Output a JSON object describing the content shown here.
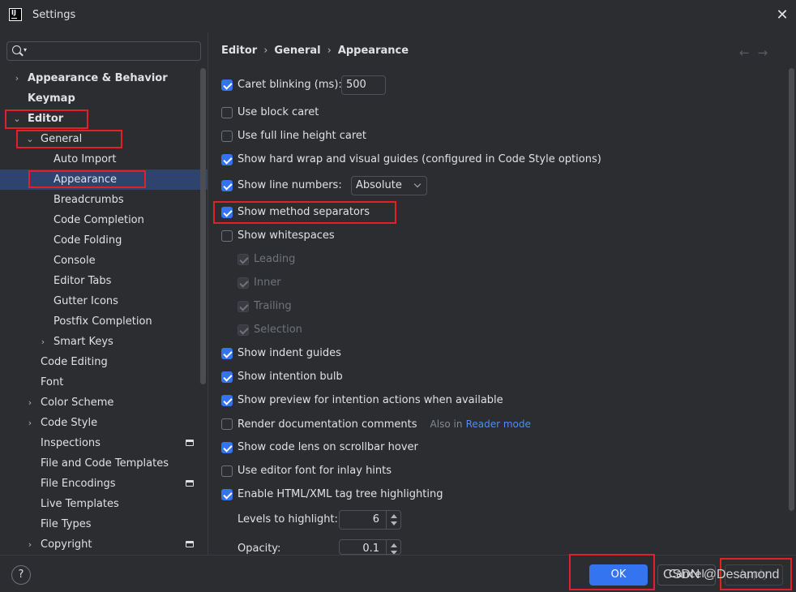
{
  "window": {
    "title": "Settings",
    "logo_text": "IJ",
    "close_glyph": "✕"
  },
  "search": {
    "placeholder": ""
  },
  "sidebar": {
    "items": [
      {
        "label": "Appearance & Behavior",
        "arrow": "›"
      },
      {
        "label": "Keymap"
      },
      {
        "label": "Editor",
        "arrow": "⌄"
      },
      {
        "label": "General",
        "arrow": "⌄"
      },
      {
        "label": "Auto Import"
      },
      {
        "label": "Appearance"
      },
      {
        "label": "Breadcrumbs"
      },
      {
        "label": "Code Completion"
      },
      {
        "label": "Code Folding"
      },
      {
        "label": "Console"
      },
      {
        "label": "Editor Tabs"
      },
      {
        "label": "Gutter Icons"
      },
      {
        "label": "Postfix Completion"
      },
      {
        "label": "Smart Keys",
        "arrow": "›"
      },
      {
        "label": "Code Editing"
      },
      {
        "label": "Font"
      },
      {
        "label": "Color Scheme",
        "arrow": "›"
      },
      {
        "label": "Code Style",
        "arrow": "›"
      },
      {
        "label": "Inspections"
      },
      {
        "label": "File and Code Templates"
      },
      {
        "label": "File Encodings"
      },
      {
        "label": "Live Templates"
      },
      {
        "label": "File Types"
      },
      {
        "label": "Copyright",
        "arrow": "›"
      }
    ]
  },
  "breadcrumb": {
    "part1": "Editor",
    "part2": "General",
    "part3": "Appearance",
    "sep": "›"
  },
  "nav": {
    "back": "←",
    "forward": "→"
  },
  "options": {
    "caret_blinking": "Caret blinking (ms):",
    "caret_blinking_value": "500",
    "block_caret": "Use block caret",
    "full_line_caret": "Use full line height caret",
    "hard_wrap": "Show hard wrap and visual guides (configured in Code Style options)",
    "line_numbers": "Show line numbers:",
    "line_numbers_value": "Absolute",
    "method_separators": "Show method separators",
    "whitespaces": "Show whitespaces",
    "leading": "Leading",
    "inner": "Inner",
    "trailing": "Trailing",
    "selection": "Selection",
    "indent_guides": "Show indent guides",
    "intention_bulb": "Show intention bulb",
    "preview_intention": "Show preview for intention actions when available",
    "render_docs": "Render documentation comments",
    "render_docs_hint": "Also in",
    "render_docs_link": "Reader mode",
    "code_lens": "Show code lens on scrollbar hover",
    "inlay_font": "Use editor font for inlay hints",
    "tag_tree": "Enable HTML/XML tag tree highlighting",
    "levels_label": "Levels to highlight:",
    "levels_value": "6",
    "opacity_label": "Opacity:",
    "opacity_value": "0.1"
  },
  "footer": {
    "help": "?",
    "ok": "OK",
    "cancel": "Cancel",
    "apply": "Apply"
  },
  "watermark": "CSDN @Desamond",
  "colors": {
    "accent": "#3574f0",
    "selection": "#2e436e",
    "highlight": "#e3202a",
    "background": "#2b2d30"
  }
}
